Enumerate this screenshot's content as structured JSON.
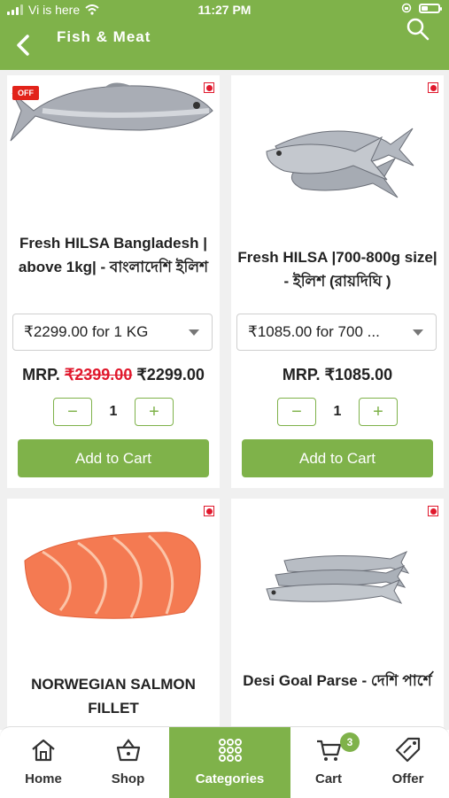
{
  "status": {
    "carrier": "Vi is here",
    "time": "11:27 PM"
  },
  "header": {
    "title": "Fish & Meat"
  },
  "products": [
    {
      "badge": "OFF",
      "name": "Fresh HILSA Bangladesh | above 1kg| - বাংলাদেশি ইলিশ",
      "variant": "₹2299.00 for 1 KG",
      "mrp_label": "MRP.",
      "mrp_old": "₹2399.00",
      "price": "₹2299.00",
      "qty": "1",
      "add_label": "Add to Cart"
    },
    {
      "name": "Fresh HILSA |700-800g size| - ইলিশ (রায়দিঘি )",
      "variant": "₹1085.00 for 700 ...",
      "mrp_label": "MRP.",
      "price": "₹1085.00",
      "qty": "1",
      "add_label": "Add to Cart"
    },
    {
      "name": "NORWEGIAN SALMON FILLET"
    },
    {
      "name": "Desi Goal Parse - দেশি পার্শে"
    }
  ],
  "tabs": [
    {
      "label": "Home",
      "icon": "home-icon"
    },
    {
      "label": "Shop",
      "icon": "basket-icon"
    },
    {
      "label": "Categories",
      "icon": "grid-icon"
    },
    {
      "label": "Cart",
      "icon": "cart-icon",
      "badge": "3"
    },
    {
      "label": "Offer",
      "icon": "tag-icon"
    }
  ],
  "colors": {
    "accent": "#7fb24a",
    "red": "#e0182c"
  }
}
